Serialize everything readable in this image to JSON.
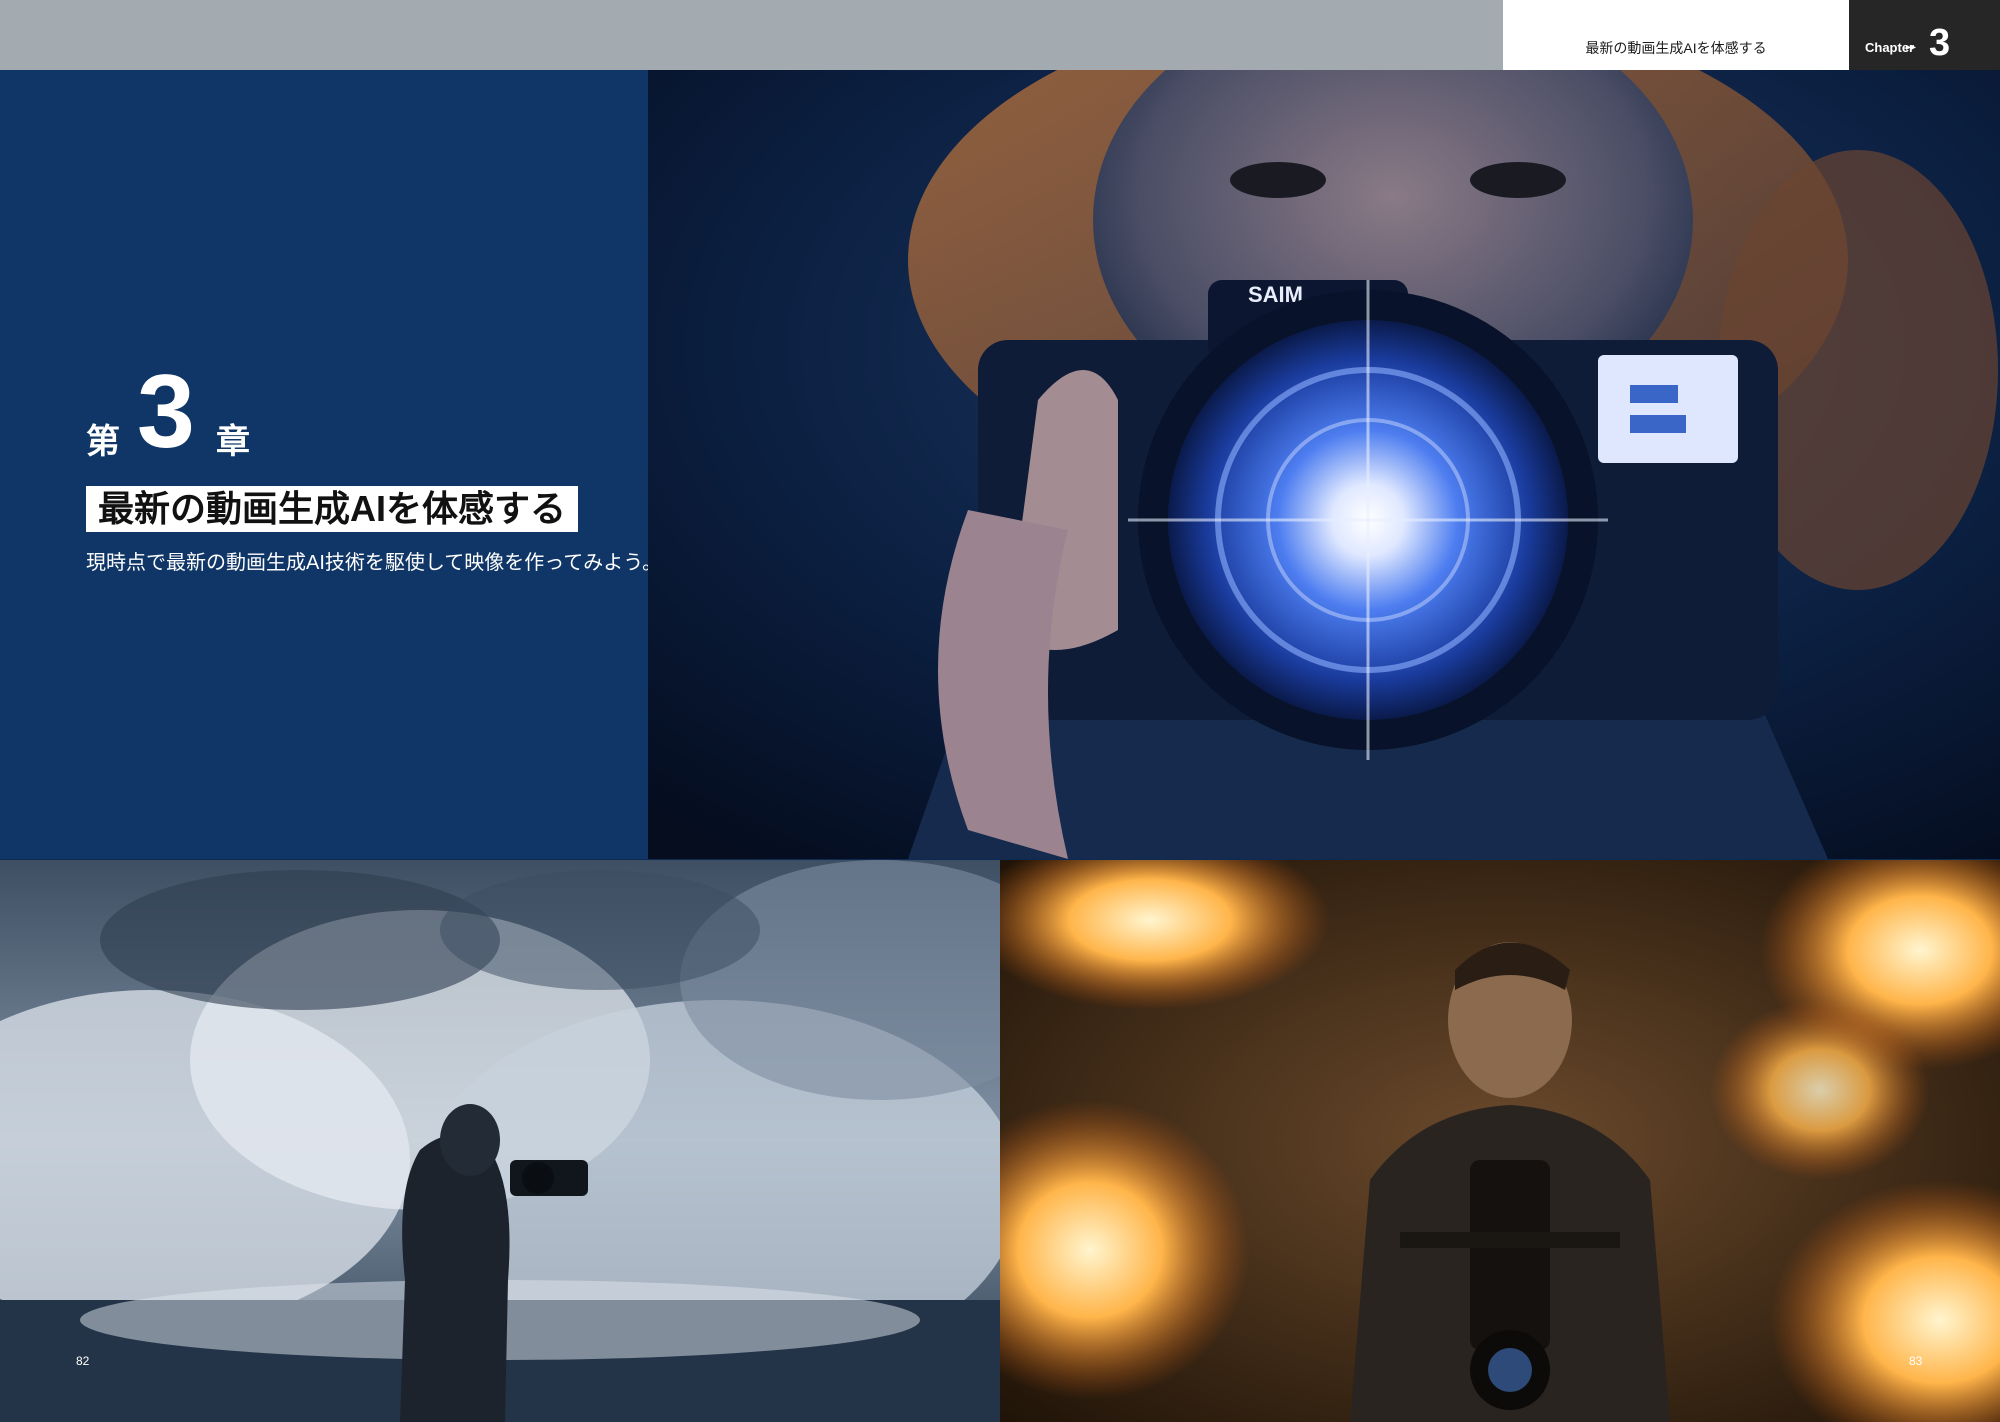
{
  "header": {
    "running_title": "最新の動画生成AIを体感する",
    "chapter_label": "Chapter",
    "chapter_number": "3"
  },
  "chapter": {
    "prefix": "第",
    "number": "3",
    "suffix": "章",
    "title": "最新の動画生成AIを体感する",
    "subtitle": "現時点で最新の動画生成AI技術を駆使して映像を作ってみよう。"
  },
  "hero_photo": {
    "camera_brand": "SAIM"
  },
  "pages": {
    "left": "82",
    "right": "83"
  },
  "colors": {
    "navy_panel": "#0f3666",
    "top_bar": "#a3abb1",
    "chapter_box": "#262626"
  }
}
